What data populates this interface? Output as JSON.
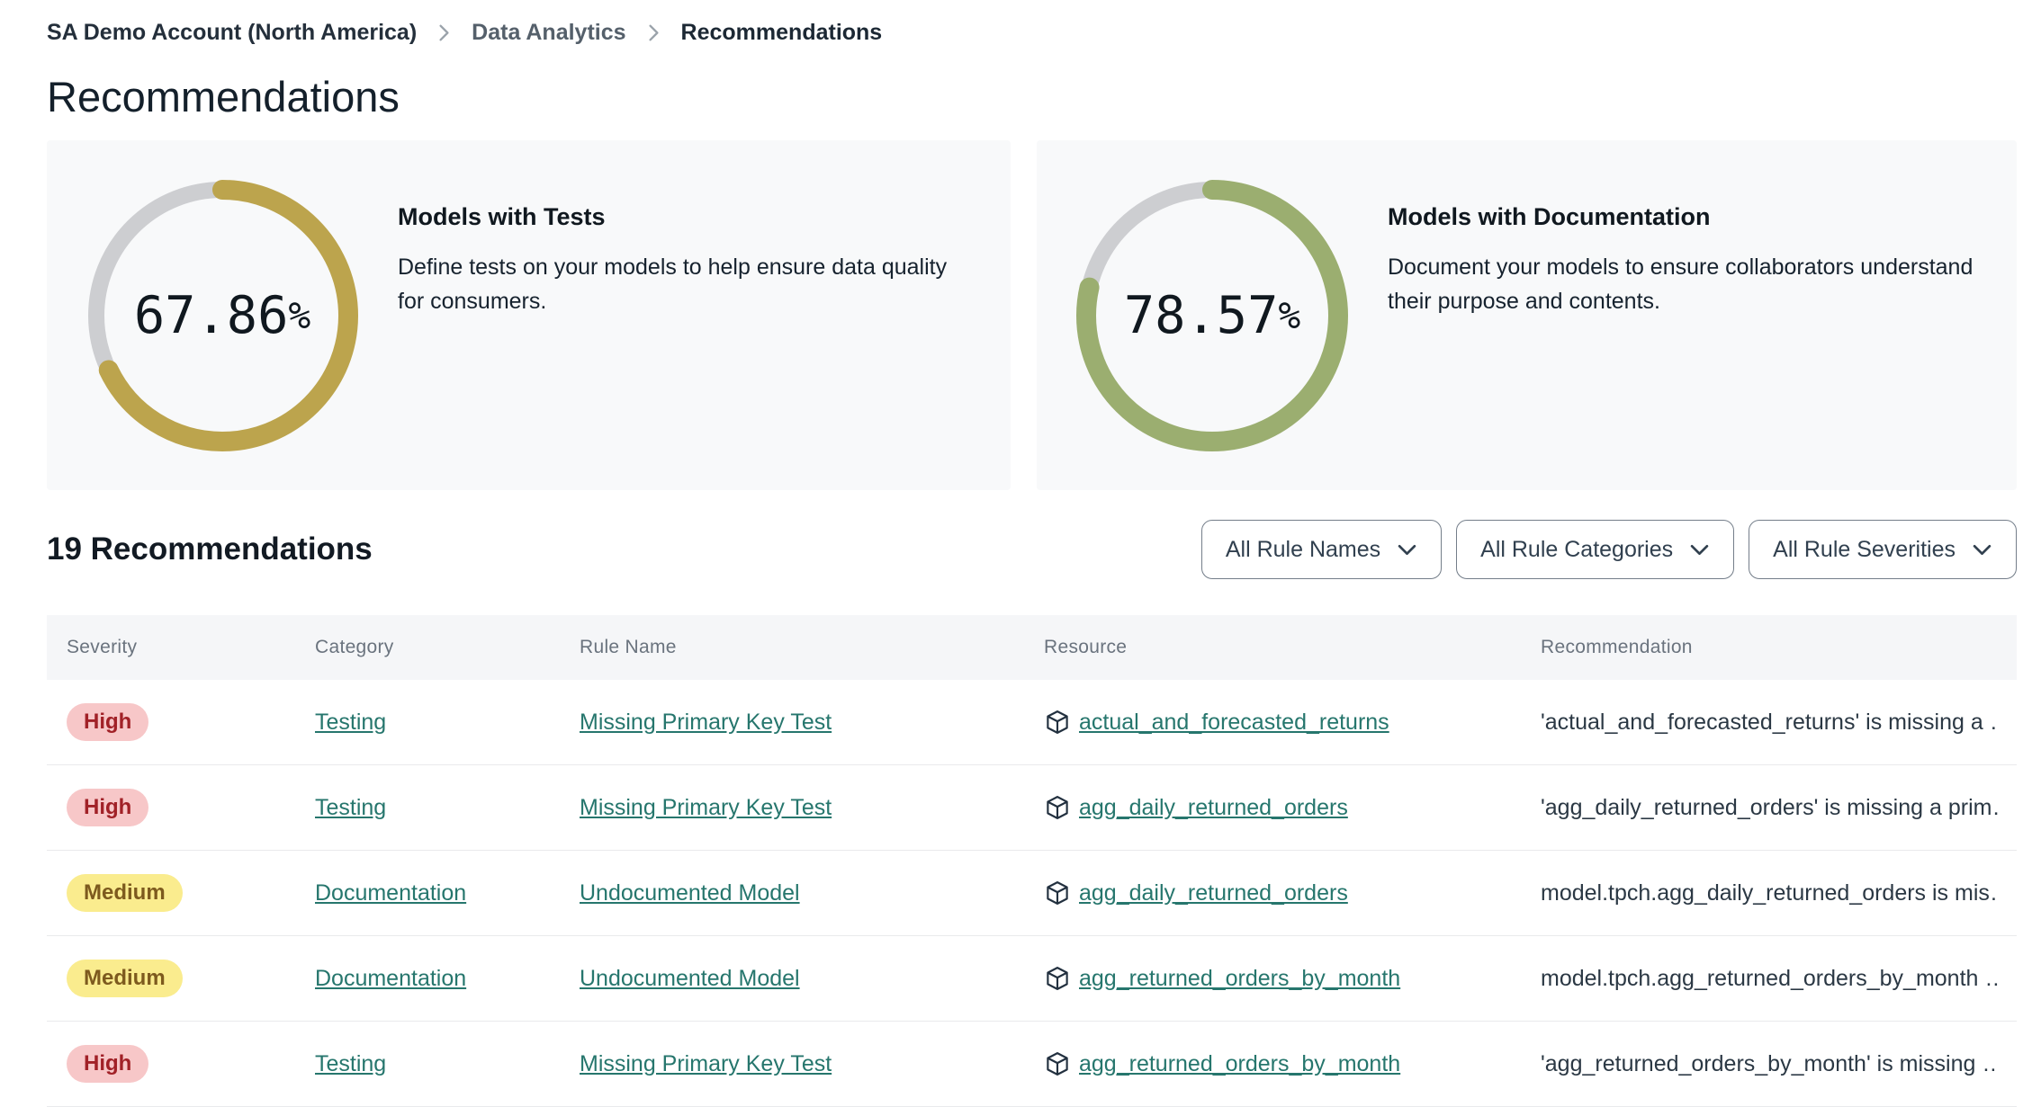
{
  "breadcrumb": {
    "items": [
      {
        "label": "SA Demo Account (North America)"
      },
      {
        "label": "Data Analytics"
      },
      {
        "label": "Recommendations"
      }
    ]
  },
  "page_title": "Recommendations",
  "summary_cards": [
    {
      "title": "Models with Tests",
      "description": "Define tests on your models to help ensure data quality for consumers.",
      "percent": 67.86,
      "percent_value": "67.86",
      "percent_suffix": "%",
      "ring_color": "#BCA44D"
    },
    {
      "title": "Models with Documentation",
      "description": "Document your models to ensure collaborators understand their purpose and contents.",
      "percent": 78.57,
      "percent_value": "78.57",
      "percent_suffix": "%",
      "ring_color": "#9BAE70"
    }
  ],
  "list_header": {
    "count_label": "19 Recommendations"
  },
  "filters": [
    {
      "label": "All Rule Names",
      "icon": "chevron-down"
    },
    {
      "label": "All Rule Categories",
      "icon": "chevron-down"
    },
    {
      "label": "All Rule Severities",
      "icon": "chevron-down"
    }
  ],
  "table": {
    "columns": [
      "Severity",
      "Category",
      "Rule Name",
      "Resource",
      "Recommendation"
    ],
    "rows": [
      {
        "severity": "High",
        "severity_level": "high",
        "category": "Testing",
        "rule_name": "Missing Primary Key Test",
        "resource": "actual_and_forecasted_returns",
        "resource_icon": "cube",
        "recommendation": "'actual_and_forecasted_returns' is missing a …"
      },
      {
        "severity": "High",
        "severity_level": "high",
        "category": "Testing",
        "rule_name": "Missing Primary Key Test",
        "resource": "agg_daily_returned_orders",
        "resource_icon": "cube",
        "recommendation": "'agg_daily_returned_orders' is missing a prim…"
      },
      {
        "severity": "Medium",
        "severity_level": "medium",
        "category": "Documentation",
        "rule_name": "Undocumented Model",
        "resource": "agg_daily_returned_orders",
        "resource_icon": "cube",
        "recommendation": "model.tpch.agg_daily_returned_orders is mis…"
      },
      {
        "severity": "Medium",
        "severity_level": "medium",
        "category": "Documentation",
        "rule_name": "Undocumented Model",
        "resource": "agg_returned_orders_by_month",
        "resource_icon": "cube",
        "recommendation": "model.tpch.agg_returned_orders_by_month …"
      },
      {
        "severity": "High",
        "severity_level": "high",
        "category": "Testing",
        "rule_name": "Missing Primary Key Test",
        "resource": "agg_returned_orders_by_month",
        "resource_icon": "cube",
        "recommendation": "'agg_returned_orders_by_month' is missing …"
      }
    ]
  },
  "colors": {
    "link": "#26766D",
    "card_bg": "#F8F9FA",
    "donut_track": "#CDCED1",
    "donut_tests": "#BCA44D",
    "donut_docs": "#9BAE70",
    "badge_high_bg": "#F7C7C8",
    "badge_high_text": "#A12127",
    "badge_medium_bg": "#FAEC8E",
    "badge_medium_text": "#7D5A1E"
  }
}
